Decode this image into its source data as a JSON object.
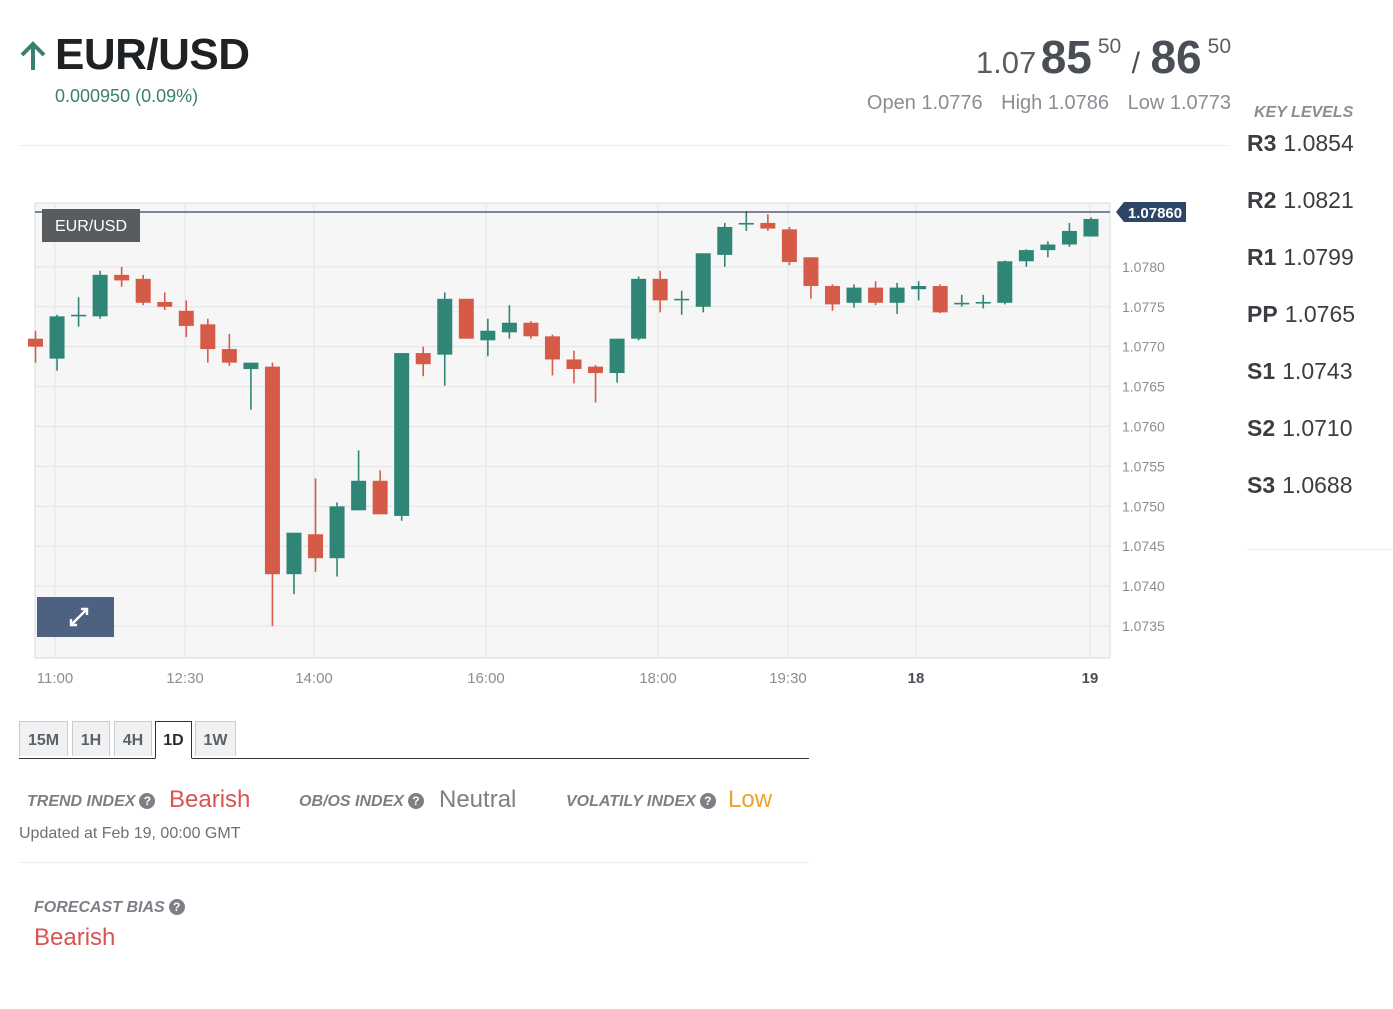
{
  "header": {
    "symbol": "EUR/USD",
    "direction_icon": "arrow-up-icon",
    "change": "0.000950 (0.09%)",
    "bid": {
      "prefix": "1.07",
      "big": "85",
      "sup": "50"
    },
    "slash": "/",
    "ask": {
      "big": "86",
      "sup": "50"
    },
    "open": "Open 1.0776",
    "high": "High 1.0786",
    "low": "Low 1.0773"
  },
  "key_levels": {
    "title": "KEY LEVELS",
    "levels": [
      {
        "name": "R3",
        "value": "1.0854"
      },
      {
        "name": "R2",
        "value": "1.0821"
      },
      {
        "name": "R1",
        "value": "1.0799"
      },
      {
        "name": "PP",
        "value": "1.0765"
      },
      {
        "name": "S1",
        "value": "1.0743"
      },
      {
        "name": "S2",
        "value": "1.0710"
      },
      {
        "name": "S3",
        "value": "1.0688"
      }
    ]
  },
  "chart_data": {
    "type": "candlestick",
    "title": "EUR/USD",
    "current_price_label": "1.07860",
    "current_price": 1.0786,
    "ylim": [
      1.0731,
      1.0788
    ],
    "y_ticks": [
      "1.0780",
      "1.0775",
      "1.0770",
      "1.0765",
      "1.0760",
      "1.0755",
      "1.0750",
      "1.0745",
      "1.0740",
      "1.0735"
    ],
    "x_ticks": [
      {
        "label": "11:00",
        "bold": false
      },
      {
        "label": "12:30",
        "bold": false
      },
      {
        "label": "14:00",
        "bold": false
      },
      {
        "label": "16:00",
        "bold": false
      },
      {
        "label": "18:00",
        "bold": false
      },
      {
        "label": "19:30",
        "bold": false
      },
      {
        "label": "18",
        "bold": true
      },
      {
        "label": "19",
        "bold": true
      }
    ],
    "grid": true,
    "candles": [
      {
        "o": 1.0771,
        "h": 1.0772,
        "l": 1.0768,
        "c": 1.077
      },
      {
        "o": 1.07685,
        "h": 1.0774,
        "l": 1.0767,
        "c": 1.07738
      },
      {
        "o": 1.0774,
        "h": 1.07762,
        "l": 1.07725,
        "c": 1.0774
      },
      {
        "o": 1.07738,
        "h": 1.07795,
        "l": 1.07735,
        "c": 1.0779
      },
      {
        "o": 1.0779,
        "h": 1.078,
        "l": 1.07775,
        "c": 1.07783
      },
      {
        "o": 1.07785,
        "h": 1.0779,
        "l": 1.07752,
        "c": 1.07755
      },
      {
        "o": 1.07756,
        "h": 1.07768,
        "l": 1.07746,
        "c": 1.0775
      },
      {
        "o": 1.07745,
        "h": 1.07758,
        "l": 1.07712,
        "c": 1.07726
      },
      {
        "o": 1.07728,
        "h": 1.07735,
        "l": 1.0768,
        "c": 1.07697
      },
      {
        "o": 1.07697,
        "h": 1.07716,
        "l": 1.07676,
        "c": 1.0768
      },
      {
        "o": 1.07672,
        "h": 1.0768,
        "l": 1.07621,
        "c": 1.0768
      },
      {
        "o": 1.07675,
        "h": 1.0768,
        "l": 1.0735,
        "c": 1.07415
      },
      {
        "o": 1.07415,
        "h": 1.07465,
        "l": 1.0739,
        "c": 1.07467
      },
      {
        "o": 1.07465,
        "h": 1.07535,
        "l": 1.07418,
        "c": 1.07435
      },
      {
        "o": 1.07435,
        "h": 1.07505,
        "l": 1.07412,
        "c": 1.075
      },
      {
        "o": 1.07495,
        "h": 1.0757,
        "l": 1.07495,
        "c": 1.07532
      },
      {
        "o": 1.07532,
        "h": 1.07545,
        "l": 1.07492,
        "c": 1.0749
      },
      {
        "o": 1.07488,
        "h": 1.07692,
        "l": 1.07482,
        "c": 1.07692
      },
      {
        "o": 1.07692,
        "h": 1.077,
        "l": 1.07663,
        "c": 1.07678
      },
      {
        "o": 1.0769,
        "h": 1.07768,
        "l": 1.07651,
        "c": 1.0776
      },
      {
        "o": 1.0776,
        "h": 1.0776,
        "l": 1.07713,
        "c": 1.0771
      },
      {
        "o": 1.07708,
        "h": 1.07735,
        "l": 1.07688,
        "c": 1.0772
      },
      {
        "o": 1.07718,
        "h": 1.07752,
        "l": 1.0771,
        "c": 1.0773
      },
      {
        "o": 1.0773,
        "h": 1.07732,
        "l": 1.0771,
        "c": 1.07713
      },
      {
        "o": 1.07713,
        "h": 1.07715,
        "l": 1.07664,
        "c": 1.07684
      },
      {
        "o": 1.07684,
        "h": 1.07695,
        "l": 1.07654,
        "c": 1.07672
      },
      {
        "o": 1.07675,
        "h": 1.07677,
        "l": 1.0763,
        "c": 1.07667
      },
      {
        "o": 1.07667,
        "h": 1.0771,
        "l": 1.07655,
        "c": 1.0771
      },
      {
        "o": 1.0771,
        "h": 1.07788,
        "l": 1.07708,
        "c": 1.07785
      },
      {
        "o": 1.07785,
        "h": 1.07795,
        "l": 1.07743,
        "c": 1.07758
      },
      {
        "o": 1.07758,
        "h": 1.0777,
        "l": 1.0774,
        "c": 1.0776
      },
      {
        "o": 1.0775,
        "h": 1.07817,
        "l": 1.07743,
        "c": 1.07817
      },
      {
        "o": 1.07815,
        "h": 1.07855,
        "l": 1.078,
        "c": 1.0785
      },
      {
        "o": 1.07853,
        "h": 1.0787,
        "l": 1.07845,
        "c": 1.07855
      },
      {
        "o": 1.07855,
        "h": 1.07866,
        "l": 1.07845,
        "c": 1.07848
      },
      {
        "o": 1.07847,
        "h": 1.0785,
        "l": 1.07802,
        "c": 1.07806
      },
      {
        "o": 1.07812,
        "h": 1.07812,
        "l": 1.0776,
        "c": 1.07776
      },
      {
        "o": 1.07776,
        "h": 1.07778,
        "l": 1.07745,
        "c": 1.07753
      },
      {
        "o": 1.07755,
        "h": 1.07778,
        "l": 1.07749,
        "c": 1.07774
      },
      {
        "o": 1.07774,
        "h": 1.07782,
        "l": 1.07752,
        "c": 1.07755
      },
      {
        "o": 1.07755,
        "h": 1.0778,
        "l": 1.07741,
        "c": 1.07774
      },
      {
        "o": 1.07772,
        "h": 1.07782,
        "l": 1.07758,
        "c": 1.07776
      },
      {
        "o": 1.07776,
        "h": 1.07778,
        "l": 1.07742,
        "c": 1.07743
      },
      {
        "o": 1.07753,
        "h": 1.07765,
        "l": 1.0775,
        "c": 1.07755
      },
      {
        "o": 1.07755,
        "h": 1.07765,
        "l": 1.07748,
        "c": 1.07756
      },
      {
        "o": 1.07755,
        "h": 1.07808,
        "l": 1.07753,
        "c": 1.07807
      },
      {
        "o": 1.07807,
        "h": 1.07822,
        "l": 1.078,
        "c": 1.07821
      },
      {
        "o": 1.07821,
        "h": 1.07832,
        "l": 1.07812,
        "c": 1.07828
      },
      {
        "o": 1.07828,
        "h": 1.07855,
        "l": 1.07825,
        "c": 1.07845
      },
      {
        "o": 1.07838,
        "h": 1.07862,
        "l": 1.07838,
        "c": 1.0786
      }
    ],
    "colors": {
      "up": "#2f8676",
      "down": "#d55b48",
      "price_line": "#2d4566"
    }
  },
  "timeframes": {
    "items": [
      "15M",
      "1H",
      "4H",
      "1D",
      "1W"
    ],
    "active": "1D"
  },
  "indices": {
    "trend_label": "TREND INDEX",
    "trend_value": "Bearish",
    "obos_label": "OB/OS INDEX",
    "obos_value": "Neutral",
    "volatility_label": "VOLATILY INDEX",
    "volatility_value": "Low",
    "updated": "Updated at Feb 19, 00:00 GMT",
    "colors": {
      "bearish": "#d9534f",
      "neutral": "#7c8086",
      "low": "#f0a030"
    }
  },
  "forecast": {
    "label": "FORECAST BIAS",
    "value": "Bearish"
  },
  "icons": {
    "help": "?",
    "expand": "expand-icon"
  }
}
